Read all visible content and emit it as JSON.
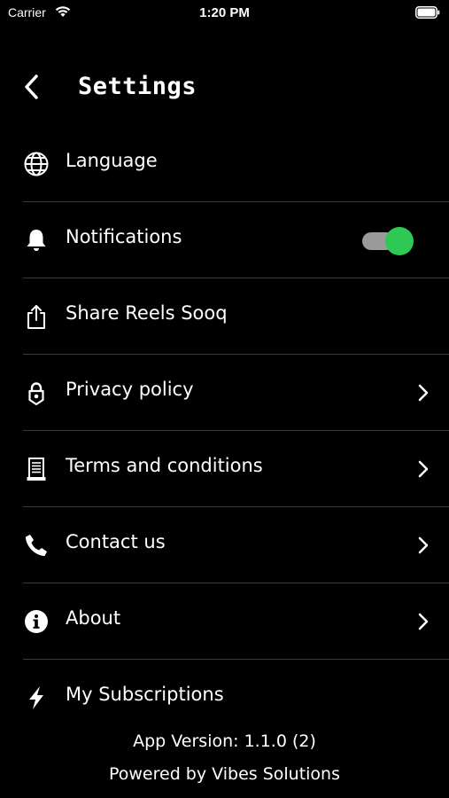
{
  "status_bar": {
    "carrier": "Carrier",
    "time": "1:20 PM",
    "icons": [
      "wifi-icon",
      "battery-icon"
    ]
  },
  "header": {
    "title": "Settings",
    "back_icon": "chevron-left-icon"
  },
  "settings": {
    "items": [
      {
        "label": "Language",
        "icon": "globe-icon"
      },
      {
        "label": "Notifications",
        "icon": "bell-icon",
        "toggle_on": true
      },
      {
        "label": "Share Reels Sooq",
        "icon": "share-icon"
      },
      {
        "label": "Privacy policy",
        "icon": "lock-icon"
      },
      {
        "label": "Terms and conditions",
        "icon": "document-icon"
      },
      {
        "label": "Contact us",
        "icon": "phone-icon"
      },
      {
        "label": "About",
        "icon": "info-icon"
      },
      {
        "label": "My Subscriptions",
        "icon": "lightning-icon"
      }
    ]
  },
  "footer": {
    "version": "App Version: 1.1.0 (2)",
    "powered_by": "Powered by Vibes Solutions"
  },
  "colors": {
    "background": "#000000",
    "text": "#ffffff",
    "toggle_on": "#2ec955",
    "divider": "#3a3a3a"
  }
}
